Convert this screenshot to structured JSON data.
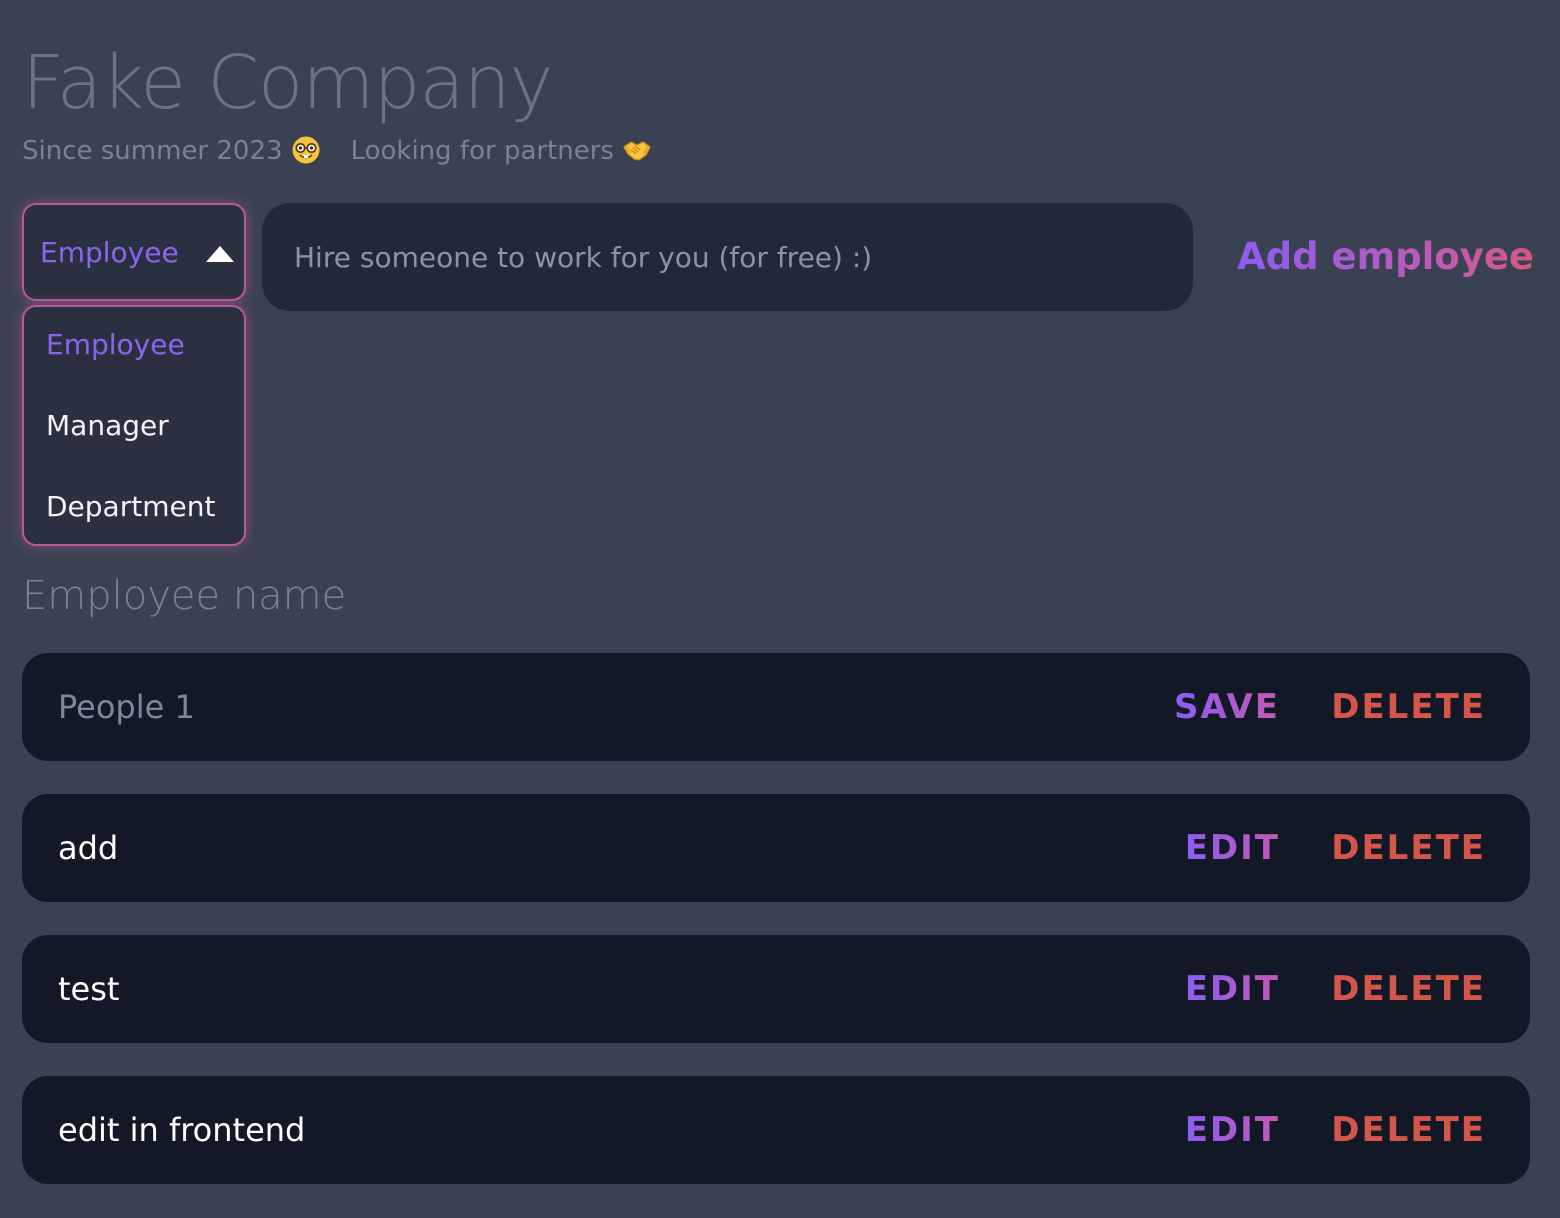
{
  "header": {
    "title": "Fake Company",
    "since": "Since summer 2023",
    "since_icon": "nerd-face-emoji",
    "partners": "Looking for partners",
    "partners_icon": "handshake-emoji"
  },
  "form": {
    "type_select": {
      "value": "Employee",
      "expanded": true,
      "options": [
        "Employee",
        "Manager",
        "Department"
      ]
    },
    "hire_input": {
      "placeholder": "Hire someone to work for you (for free) :)",
      "value": ""
    },
    "add_button_label": "Add employee"
  },
  "list": {
    "heading": "Employee name",
    "rows": [
      {
        "name": "People 1",
        "editing": true,
        "primary_label": "SAVE",
        "delete_label": "DELETE"
      },
      {
        "name": "add",
        "editing": false,
        "primary_label": "EDIT",
        "delete_label": "DELETE"
      },
      {
        "name": "test",
        "editing": false,
        "primary_label": "EDIT",
        "delete_label": "DELETE"
      },
      {
        "name": "edit in frontend",
        "editing": false,
        "primary_label": "EDIT",
        "delete_label": "DELETE"
      }
    ]
  },
  "colors": {
    "background": "#3a4152",
    "accent_purple": "#8a66f0",
    "accent_pink": "#c35ab2",
    "danger": "#d4554a",
    "row_background": "#131826"
  }
}
